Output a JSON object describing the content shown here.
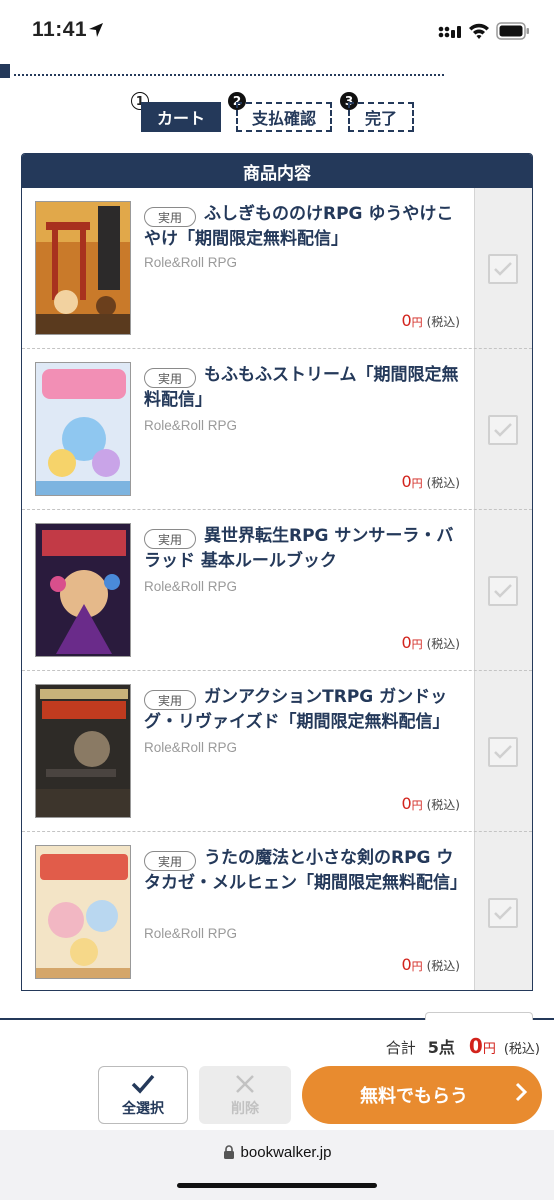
{
  "status_bar": {
    "time": "11:41"
  },
  "steps": [
    {
      "number": "1",
      "label": "カート",
      "state": "active"
    },
    {
      "number": "2",
      "label": "支払確認",
      "state": "pending"
    },
    {
      "number": "3",
      "label": "完了",
      "state": "pending"
    }
  ],
  "list": {
    "header": "商品内容",
    "items": [
      {
        "badge": "実用",
        "title": "ふしぎもののけRPG ゆうやけこやけ「期間限定無料配信」",
        "author": "Role&Roll RPG",
        "price": "0",
        "currency": "円",
        "tax": "(税込)",
        "checked": true
      },
      {
        "badge": "実用",
        "title": "もふもふストリーム「期間限定無料配信」",
        "author": "Role&Roll RPG",
        "price": "0",
        "currency": "円",
        "tax": "(税込)",
        "checked": true
      },
      {
        "badge": "実用",
        "title": "異世界転生RPG サンサーラ・バラッド 基本ルールブック",
        "author": "Role&Roll RPG",
        "price": "0",
        "currency": "円",
        "tax": "(税込)",
        "checked": true
      },
      {
        "badge": "実用",
        "title": "ガンアクションTRPG ガンドッグ・リヴァイズド「期間限定無料配信」",
        "author": "Role&Roll RPG",
        "price": "0",
        "currency": "円",
        "tax": "(税込)",
        "checked": true
      },
      {
        "badge": "実用",
        "title": "うたの魔法と小さな剣のRPG ウタカゼ・メルヒェン「期間限定無料配信」",
        "author": "Role&Roll RPG",
        "price": "0",
        "currency": "円",
        "tax": "(税込)",
        "checked": true
      }
    ]
  },
  "summary": {
    "label": "合計",
    "count": "5点",
    "amount": "0",
    "currency": "円",
    "tax": "(税込)"
  },
  "actions": {
    "select_all": "全選択",
    "delete": "削除",
    "get_free": "無料でもらう"
  },
  "browser": {
    "url": "bookwalker.jp"
  },
  "colors": {
    "navy": "#24395a",
    "orange": "#e88b2f",
    "price_red": "#d2231c"
  }
}
